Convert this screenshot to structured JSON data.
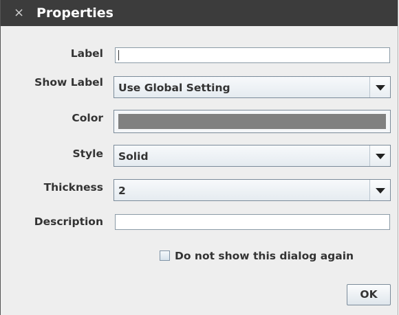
{
  "window": {
    "title": "Properties",
    "close_icon": "close-icon",
    "close_glyph": "×"
  },
  "fields": {
    "label": {
      "label": "Label",
      "value": ""
    },
    "show_label": {
      "label": "Show Label",
      "selected": "Use Global Setting"
    },
    "color": {
      "label": "Color",
      "value": "#808080"
    },
    "style": {
      "label": "Style",
      "selected": "Solid"
    },
    "thickness": {
      "label": "Thickness",
      "selected": "2"
    },
    "description": {
      "label": "Description",
      "value": ""
    }
  },
  "checkbox": {
    "label": "Do not show this dialog again",
    "checked": false
  },
  "buttons": {
    "ok_label": "OK"
  },
  "colors": {
    "titlebar": "#3c3c3c",
    "dialog_bg": "#eeeeee",
    "border": "#7a8a99"
  }
}
